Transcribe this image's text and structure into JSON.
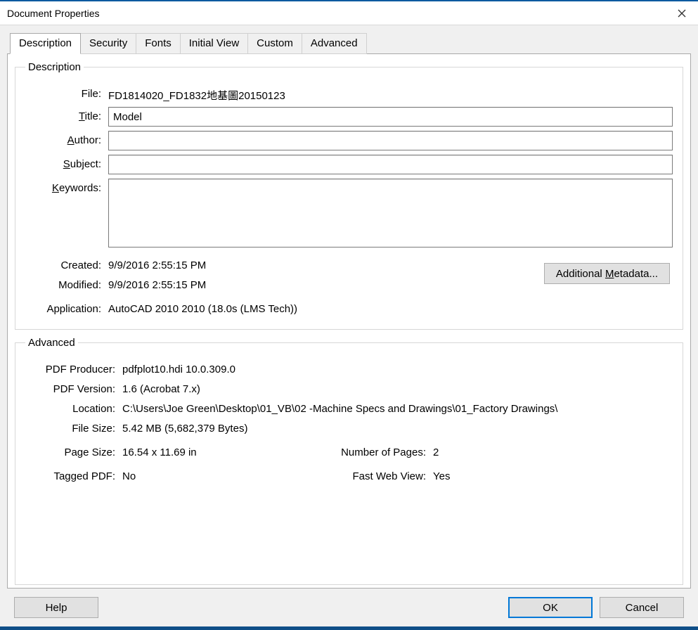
{
  "window": {
    "title": "Document Properties"
  },
  "tabs": {
    "description": "Description",
    "security": "Security",
    "fonts": "Fonts",
    "initial_view": "Initial View",
    "custom": "Custom",
    "advanced": "Advanced"
  },
  "description": {
    "legend": "Description",
    "file_label": "File:",
    "file_value": "FD1814020_FD1832地基圖20150123",
    "title_label_pre": "",
    "title_label_u": "T",
    "title_label_post": "itle:",
    "title_value": "Model",
    "author_label_pre": "",
    "author_label_u": "A",
    "author_label_post": "uthor:",
    "author_value": "",
    "subject_label_pre": "",
    "subject_label_u": "S",
    "subject_label_post": "ubject:",
    "subject_value": "",
    "keywords_label_pre": "",
    "keywords_label_u": "K",
    "keywords_label_post": "eywords:",
    "keywords_value": "",
    "created_label": "Created:",
    "created_value": "9/9/2016 2:55:15 PM",
    "modified_label": "Modified:",
    "modified_value": "9/9/2016 2:55:15 PM",
    "application_label": "Application:",
    "application_value": "AutoCAD 2010 2010 (18.0s (LMS Tech))",
    "additional_metadata_pre": "Additional ",
    "additional_metadata_u": "M",
    "additional_metadata_post": "etadata..."
  },
  "advanced": {
    "legend": "Advanced",
    "pdf_producer_label": "PDF Producer:",
    "pdf_producer_value": "pdfplot10.hdi 10.0.309.0",
    "pdf_version_label": "PDF Version:",
    "pdf_version_value": "1.6 (Acrobat 7.x)",
    "location_label": "Location:",
    "location_value": "C:\\Users\\Joe Green\\Desktop\\01_VB\\02 -Machine Specs and Drawings\\01_Factory Drawings\\",
    "file_size_label": "File Size:",
    "file_size_value": "5.42 MB (5,682,379 Bytes)",
    "page_size_label": "Page Size:",
    "page_size_value": "16.54 x 11.69 in",
    "num_pages_label": "Number of Pages:",
    "num_pages_value": "2",
    "tagged_label": "Tagged PDF:",
    "tagged_value": "No",
    "fast_web_label": "Fast Web View:",
    "fast_web_value": "Yes"
  },
  "buttons": {
    "help": "Help",
    "ok": "OK",
    "cancel": "Cancel"
  }
}
